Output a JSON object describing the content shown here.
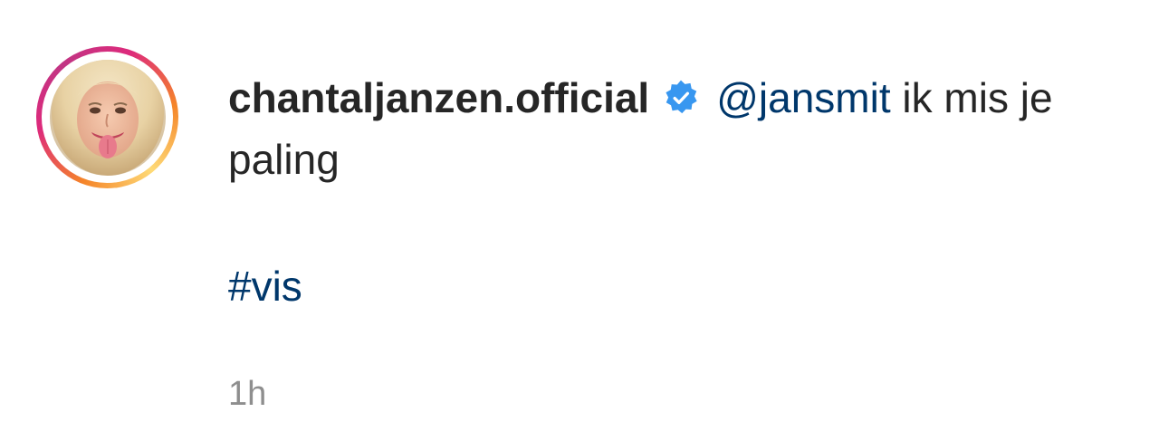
{
  "post": {
    "author": {
      "username": "chantaljanzen.official",
      "verified": true,
      "avatar_icon": "profile-photo",
      "story_ring_colors": [
        "#f58529",
        "#dd2a7b",
        "#c13584",
        "#feda77"
      ]
    },
    "caption": {
      "mention": "@jansmit",
      "text_after_mention": " ik mis je paling",
      "hashtag": "#vis"
    },
    "timestamp": "1h"
  },
  "colors": {
    "text": "#262626",
    "link": "#00376b",
    "verified_badge": "#3897f0",
    "muted": "#8e8e8e"
  }
}
